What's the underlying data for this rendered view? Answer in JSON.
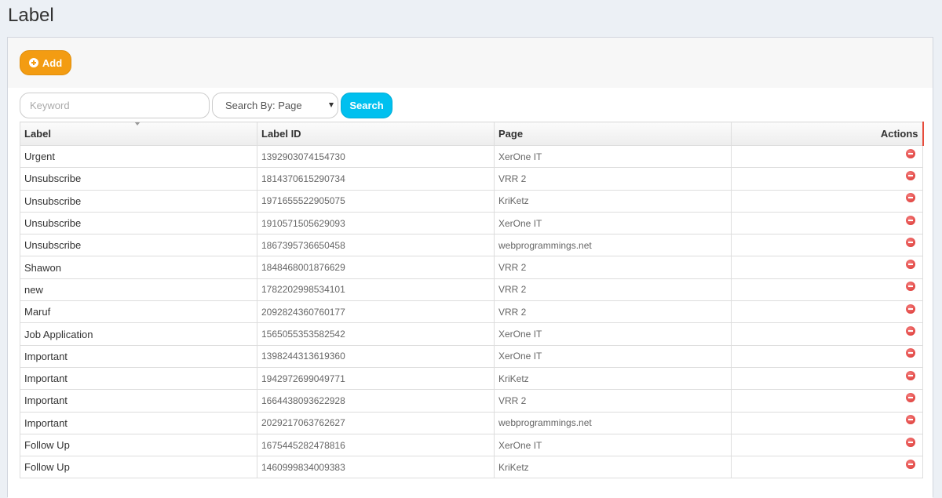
{
  "page": {
    "title": "Label"
  },
  "toolbar": {
    "add_label": "Add"
  },
  "search": {
    "keyword_placeholder": "Keyword",
    "keyword_value": "",
    "search_by_selected": "Search By: Page",
    "search_button_label": "Search"
  },
  "table": {
    "columns": [
      "Label",
      "Label ID",
      "Page",
      "Actions"
    ],
    "rows": [
      {
        "label": "Urgent",
        "label_id": "1392903074154730",
        "page": "XerOne IT"
      },
      {
        "label": "Unsubscribe",
        "label_id": "1814370615290734",
        "page": "VRR 2"
      },
      {
        "label": "Unsubscribe",
        "label_id": "1971655522905075",
        "page": "KriKetz"
      },
      {
        "label": "Unsubscribe",
        "label_id": "1910571505629093",
        "page": "XerOne IT"
      },
      {
        "label": "Unsubscribe",
        "label_id": "1867395736650458",
        "page": "webprogrammings.net"
      },
      {
        "label": "Shawon",
        "label_id": "1848468001876629",
        "page": "VRR 2"
      },
      {
        "label": "new",
        "label_id": "1782202998534101",
        "page": "VRR 2"
      },
      {
        "label": "Maruf",
        "label_id": "2092824360760177",
        "page": "VRR 2"
      },
      {
        "label": "Job Application",
        "label_id": "1565055353582542",
        "page": "XerOne IT"
      },
      {
        "label": "Important",
        "label_id": "1398244313619360",
        "page": "XerOne IT"
      },
      {
        "label": "Important",
        "label_id": "1942972699049771",
        "page": "KriKetz"
      },
      {
        "label": "Important",
        "label_id": "1664438093622928",
        "page": "VRR 2"
      },
      {
        "label": "Important",
        "label_id": "2029217063762627",
        "page": "webprogrammings.net"
      },
      {
        "label": "Follow Up",
        "label_id": "1675445282478816",
        "page": "XerOne IT"
      },
      {
        "label": "Follow Up",
        "label_id": "1460999834009383",
        "page": "KriKetz"
      }
    ]
  },
  "icons": {
    "add": "plus-circle-icon",
    "delete": "minus-circle-icon"
  },
  "colors": {
    "add_button": "#f39c12",
    "search_button": "#00c0ef",
    "delete_icon": "#d9302b"
  }
}
